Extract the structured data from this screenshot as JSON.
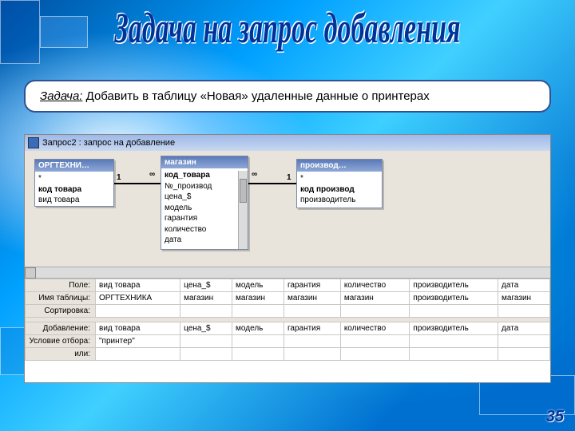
{
  "slide": {
    "title": "Задача на запрос добавления",
    "task_label": "Задача:",
    "task_text": " Добавить в таблицу «Новая» удаленные данные о принтерах",
    "page_number": "35"
  },
  "access": {
    "window_title": "Запрос2 : запрос на добавление",
    "tables": {
      "t1": {
        "header": "ОРГТЕХНИ…",
        "rows": [
          "*",
          "код товара",
          "вид товара"
        ],
        "bold_idx": 1
      },
      "t2": {
        "header": "магазин",
        "rows": [
          "код_товара",
          "№_производ",
          "цена_$",
          "модель",
          "гарантия",
          "количество",
          "дата"
        ],
        "bold_idx": 0
      },
      "t3": {
        "header": "производ…",
        "rows": [
          "*",
          "код производ",
          "производитель"
        ],
        "bold_idx": 1
      }
    },
    "rel": {
      "left1": "1",
      "left2": "∞",
      "right1": "∞",
      "right2": "1"
    },
    "grid": {
      "row_labels": [
        "Поле:",
        "Имя таблицы:",
        "Сортировка:",
        "Добавление:",
        "Условие отбора:",
        "или:"
      ],
      "cols": [
        {
          "field": "вид товара",
          "table": "ОРГТЕХНИКА",
          "append": "вид товара",
          "cond": "\"принтер\""
        },
        {
          "field": "цена_$",
          "table": "магазин",
          "append": "цена_$",
          "cond": ""
        },
        {
          "field": "модель",
          "table": "магазин",
          "append": "модель",
          "cond": ""
        },
        {
          "field": "гарантия",
          "table": "магазин",
          "append": "гарантия",
          "cond": ""
        },
        {
          "field": "количество",
          "table": "магазин",
          "append": "количество",
          "cond": ""
        },
        {
          "field": "производитель",
          "table": "производитель",
          "append": "производитель",
          "cond": ""
        },
        {
          "field": "дата",
          "table": "магазин",
          "append": "дата",
          "cond": ""
        }
      ]
    }
  }
}
